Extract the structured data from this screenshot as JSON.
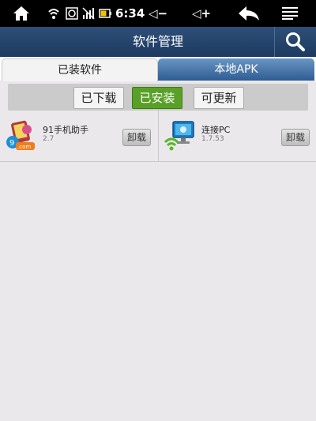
{
  "status_bar": {
    "time": "6:34",
    "volume_down": "◁−",
    "volume_up": "◁+",
    "icons": [
      "home-icon",
      "wifi-icon",
      "sync-icon",
      "signal-icon",
      "battery-icon",
      "volume-down-icon",
      "volume-up-icon",
      "back-icon",
      "menu-icon"
    ]
  },
  "header": {
    "title": "软件管理",
    "search_icon": "search-icon"
  },
  "tabs": [
    {
      "label": "已装软件",
      "active": true
    },
    {
      "label": "本地APK",
      "active": false
    }
  ],
  "filters": [
    {
      "label": "已下载",
      "active": false
    },
    {
      "label": "已安装",
      "active": true
    },
    {
      "label": "可更新",
      "active": false
    }
  ],
  "apps": [
    {
      "name": "91手机助手",
      "version": "2.7",
      "action": "卸载",
      "icon": "app-91-icon"
    },
    {
      "name": "连接PC",
      "version": "1.7.53",
      "action": "卸载",
      "icon": "connect-pc-icon"
    }
  ],
  "colors": {
    "accent_green": "#5aa028",
    "header_blue": "#1d3a60",
    "tab_blue": "#2e5c92"
  }
}
